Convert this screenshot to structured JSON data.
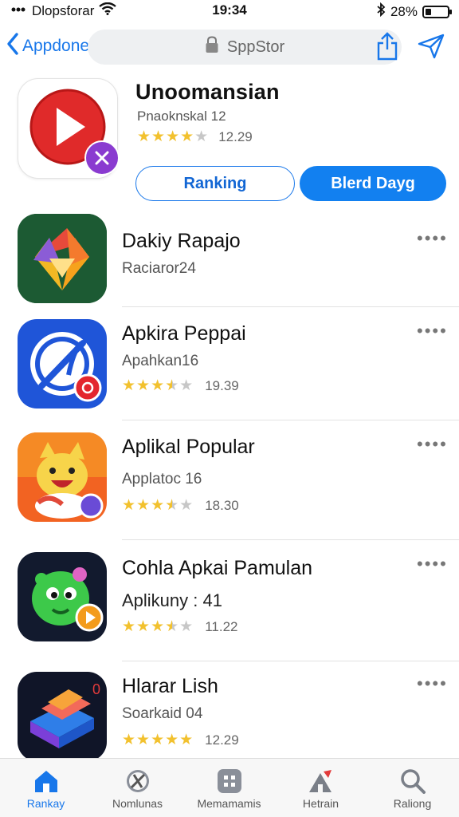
{
  "status": {
    "carrier": "Dlopsƭorar",
    "time": "19:34",
    "battery_pct": "28%",
    "battery_level": 0.28
  },
  "nav": {
    "back_label": "Appdone",
    "url": "SppStor"
  },
  "featured": {
    "title": "Unoomansian",
    "subtitle": "Pnaoknskal 12",
    "rating": 4,
    "rating_value": "12.29",
    "primary_btn": "Ranking",
    "secondary_btn": "Blerd Dayg"
  },
  "apps": [
    {
      "name": "Dakiy Rapajo",
      "subtitle": "Raciaror24",
      "rating": null,
      "rating_value": ""
    },
    {
      "name": "Apkira Peppai",
      "subtitle": "Apahkan16",
      "rating": 3.5,
      "rating_value": "19.39"
    },
    {
      "name": "Aplikal Popular",
      "subtitle": "Applatoc 16",
      "rating": 3.5,
      "rating_value": "18.30"
    },
    {
      "name": "Cohla Apkai Pamulan",
      "subtitle": "Aplikuny : 41",
      "rating": 3.5,
      "rating_value": "11.22"
    },
    {
      "name": "Hlarar Lish",
      "subtitle": "Soarkaid 04",
      "rating": 5,
      "rating_value": "12.29"
    }
  ],
  "more_label": "••••",
  "tabs": [
    {
      "label": "Rankay",
      "icon": "home-icon",
      "active": true
    },
    {
      "label": "Nomlunas",
      "icon": "compass-icon",
      "active": false
    },
    {
      "label": "Memamamis",
      "icon": "apps-icon",
      "active": false
    },
    {
      "label": "Hetrain",
      "icon": "arcade-icon",
      "active": false
    },
    {
      "label": "Raliong",
      "icon": "search-icon",
      "active": false
    }
  ],
  "colors": {
    "accent": "#1877ea",
    "star": "#f2c12e",
    "badge": "#8a3bd0"
  }
}
